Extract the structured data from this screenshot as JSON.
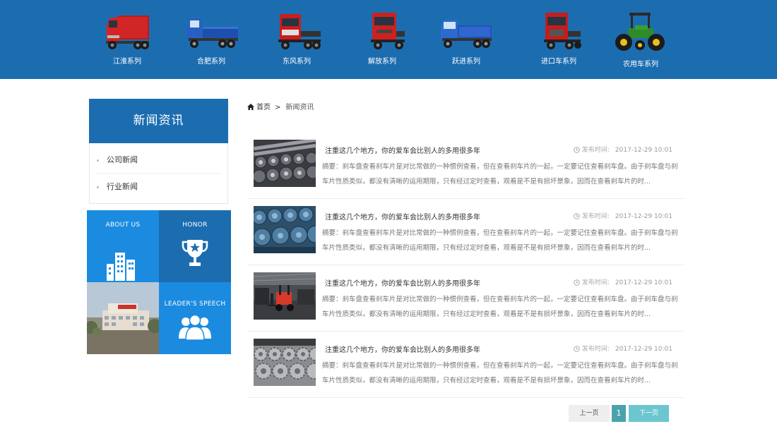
{
  "nav": {
    "items": [
      {
        "label": "江淮系列",
        "icon": "red-truck-icon",
        "color": "#d62222"
      },
      {
        "label": "合肥系列",
        "icon": "blue-truck-icon",
        "color": "#2a5fc2"
      },
      {
        "label": "东风系列",
        "icon": "red-tractor-truck-icon",
        "color": "#d62222"
      },
      {
        "label": "解放系列",
        "icon": "red-truck-icon",
        "color": "#d62222"
      },
      {
        "label": "跃进系列",
        "icon": "blue-truck-icon",
        "color": "#2a5fc2"
      },
      {
        "label": "进口车系列",
        "icon": "red-tractor-truck-icon",
        "color": "#d62222"
      },
      {
        "label": "农用车系列",
        "icon": "green-farm-tractor-icon",
        "color": "#2f8a2a"
      }
    ]
  },
  "sidebar": {
    "title": "新闻资讯",
    "items": [
      {
        "label": "公司新闻"
      },
      {
        "label": "行业新闻"
      }
    ],
    "tiles": {
      "about": "ABOUT US",
      "honor": "HONOR",
      "leader": "LEADER'S SPEECH"
    }
  },
  "breadcrumb": {
    "home": "首页",
    "separator": ">",
    "current": "新闻资讯"
  },
  "news": [
    {
      "title": "注重这几个地方，你的爱车会比别人的多用很多年",
      "date_label": "发布时间:",
      "date": "2017-12-29 10:01",
      "summary": "摘要：刹车盘查看刹车片是对比常做的一种惯例查看，但在查看刹车片的一起，一定要记住查看刹车盘。由于刹车盘与刹车片性质类似，都没有清晰的运用期限，只有经过定时查看，观看是不是有损坏景象，因而在查看刹车片的时...",
      "thumb": "steel-shafts-photo-icon"
    },
    {
      "title": "注重这几个地方，你的爱车会比别人的多用很多年",
      "date_label": "发布时间:",
      "date": "2017-12-29 10:01",
      "summary": "摘要：刹车盘查看刹车片是对比常做的一种惯例查看，但在查看刹车片的一起，一定要记住查看刹车盘。由于刹车盘与刹车片性质类似，都没有清晰的运用期限，只有经过定时查看，观看是不是有损坏景象，因而在查看刹车片的时...",
      "thumb": "axle-hubs-photo-icon"
    },
    {
      "title": "注重这几个地方，你的爱车会比别人的多用很多年",
      "date_label": "发布时间:",
      "date": "2017-12-29 10:01",
      "summary": "摘要：刹车盘查看刹车片是对比常做的一种惯例查看，但在查看刹车片的一起，一定要记住查看刹车盘。由于刹车盘与刹车片性质类似，都没有清晰的运用期限，只有经过定时查看，观看是不是有损坏景象，因而在查看刹车片的时...",
      "thumb": "forklift-workshop-photo-icon"
    },
    {
      "title": "注重这几个地方，你的爱车会比别人的多用很多年",
      "date_label": "发布时间:",
      "date": "2017-12-29 10:01",
      "summary": "摘要：刹车盘查看刹车片是对比常做的一种惯例查看，但在查看刹车片的一起，一定要记住查看刹车盘。由于刹车盘与刹车片性质类似，都没有清晰的运用期限，只有经过定时查看，观看是不是有损坏景象，因而在查看刹车片的时...",
      "thumb": "gears-photo-icon"
    }
  ],
  "pagination": {
    "prev": "上一页",
    "current": "1",
    "next": "下一页"
  },
  "colors": {
    "brand_blue": "#1c6db0",
    "tile_blue": "#1b8be0",
    "pager_teal": "#4aa3ab",
    "pager_next": "#6cc6cf"
  }
}
